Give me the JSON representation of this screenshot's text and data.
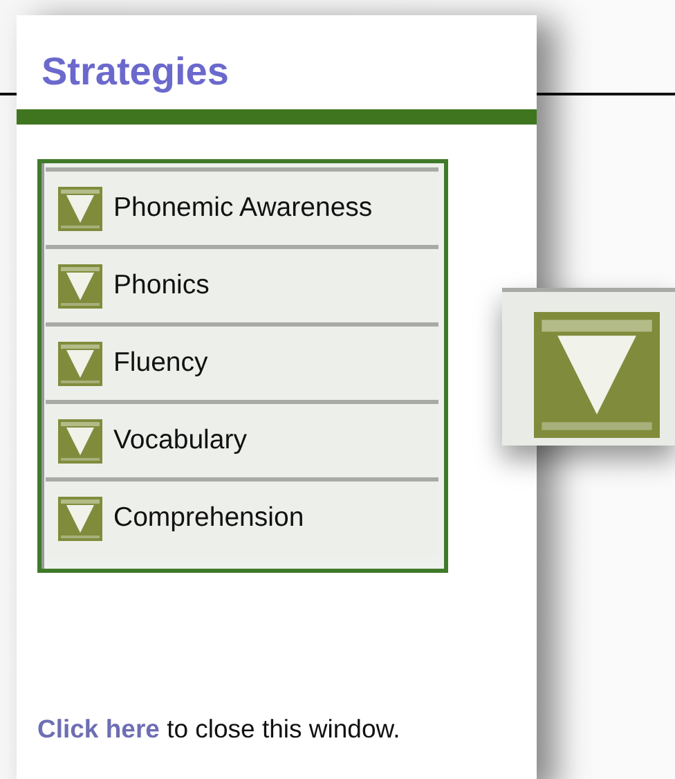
{
  "panel": {
    "title": "Strategies",
    "items": [
      {
        "label": "Phonemic Awareness"
      },
      {
        "label": "Phonics"
      },
      {
        "label": "Fluency"
      },
      {
        "label": "Vocabulary"
      },
      {
        "label": "Comprehension"
      }
    ],
    "footer": {
      "link": "Click here",
      "text": "to close this window."
    }
  }
}
